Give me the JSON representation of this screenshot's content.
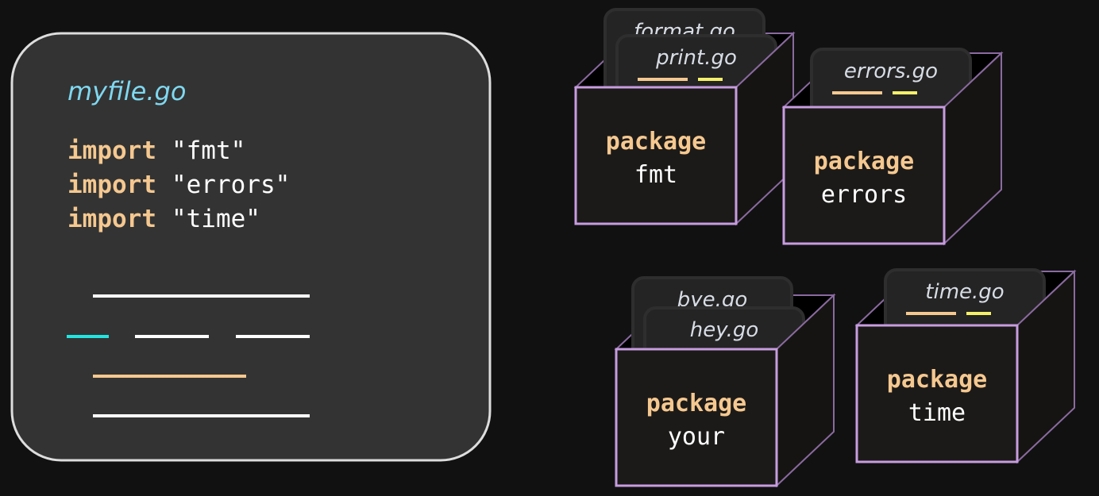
{
  "colors": {
    "background": "#111111",
    "panel": "#333333",
    "keyword": "#f5c890",
    "cyan_title": "#7fd8f0",
    "box_edge": "#c79ce0",
    "box_fill": "#1c1a18",
    "yellow": "#f5f06a",
    "cyan_line": "#22e5e0"
  },
  "code_file": {
    "filename": "myfile.go",
    "imports": [
      {
        "keyword": "import",
        "path": "\"fmt\""
      },
      {
        "keyword": "import",
        "path": "\"errors\""
      },
      {
        "keyword": "import",
        "path": "\"time\""
      }
    ]
  },
  "packages": [
    {
      "keyword": "package",
      "name": "fmt",
      "files": [
        "format.go",
        "print.go"
      ]
    },
    {
      "keyword": "package",
      "name": "errors",
      "files": [
        "errors.go"
      ]
    },
    {
      "keyword": "package",
      "name": "your",
      "files": [
        "bye.go",
        "hey.go"
      ]
    },
    {
      "keyword": "package",
      "name": "time",
      "files": [
        "time.go"
      ]
    }
  ]
}
